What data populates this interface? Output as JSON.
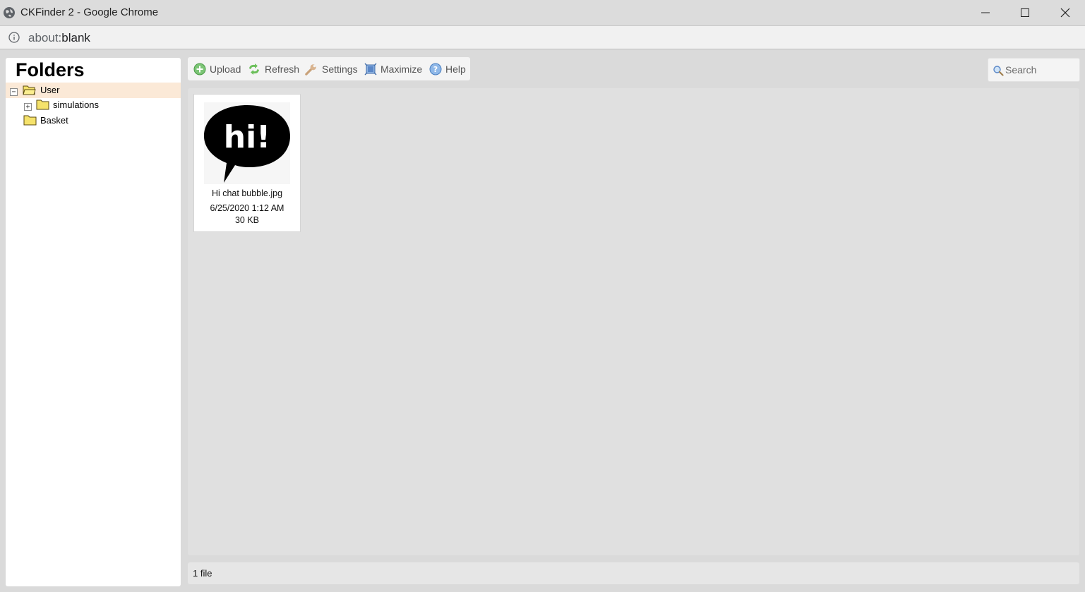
{
  "window": {
    "title": "CKFinder 2 - Google Chrome"
  },
  "address_bar": {
    "scheme": "about:",
    "path": "blank"
  },
  "folders_panel": {
    "heading": "Folders",
    "tree": [
      {
        "label": "User",
        "expanded": true,
        "selected": true
      },
      {
        "label": "simulations",
        "expanded": false,
        "selected": false
      },
      {
        "label": "Basket",
        "selected": false
      }
    ]
  },
  "toolbar": {
    "upload": "Upload",
    "refresh": "Refresh",
    "settings": "Settings",
    "maximize": "Maximize",
    "help": "Help"
  },
  "search": {
    "placeholder": "Search"
  },
  "files": [
    {
      "name": "Hi chat bubble.jpg",
      "date": "6/25/2020 1:12 AM",
      "size": "30 KB",
      "thumbnail_text": "hi!"
    }
  ],
  "status": {
    "text": "1 file"
  },
  "colors": {
    "selected_row": "#fbe9d7",
    "folder_yellow": "#f5e26b",
    "upload_green": "#5cb85c",
    "help_blue": "#4a90d9"
  }
}
